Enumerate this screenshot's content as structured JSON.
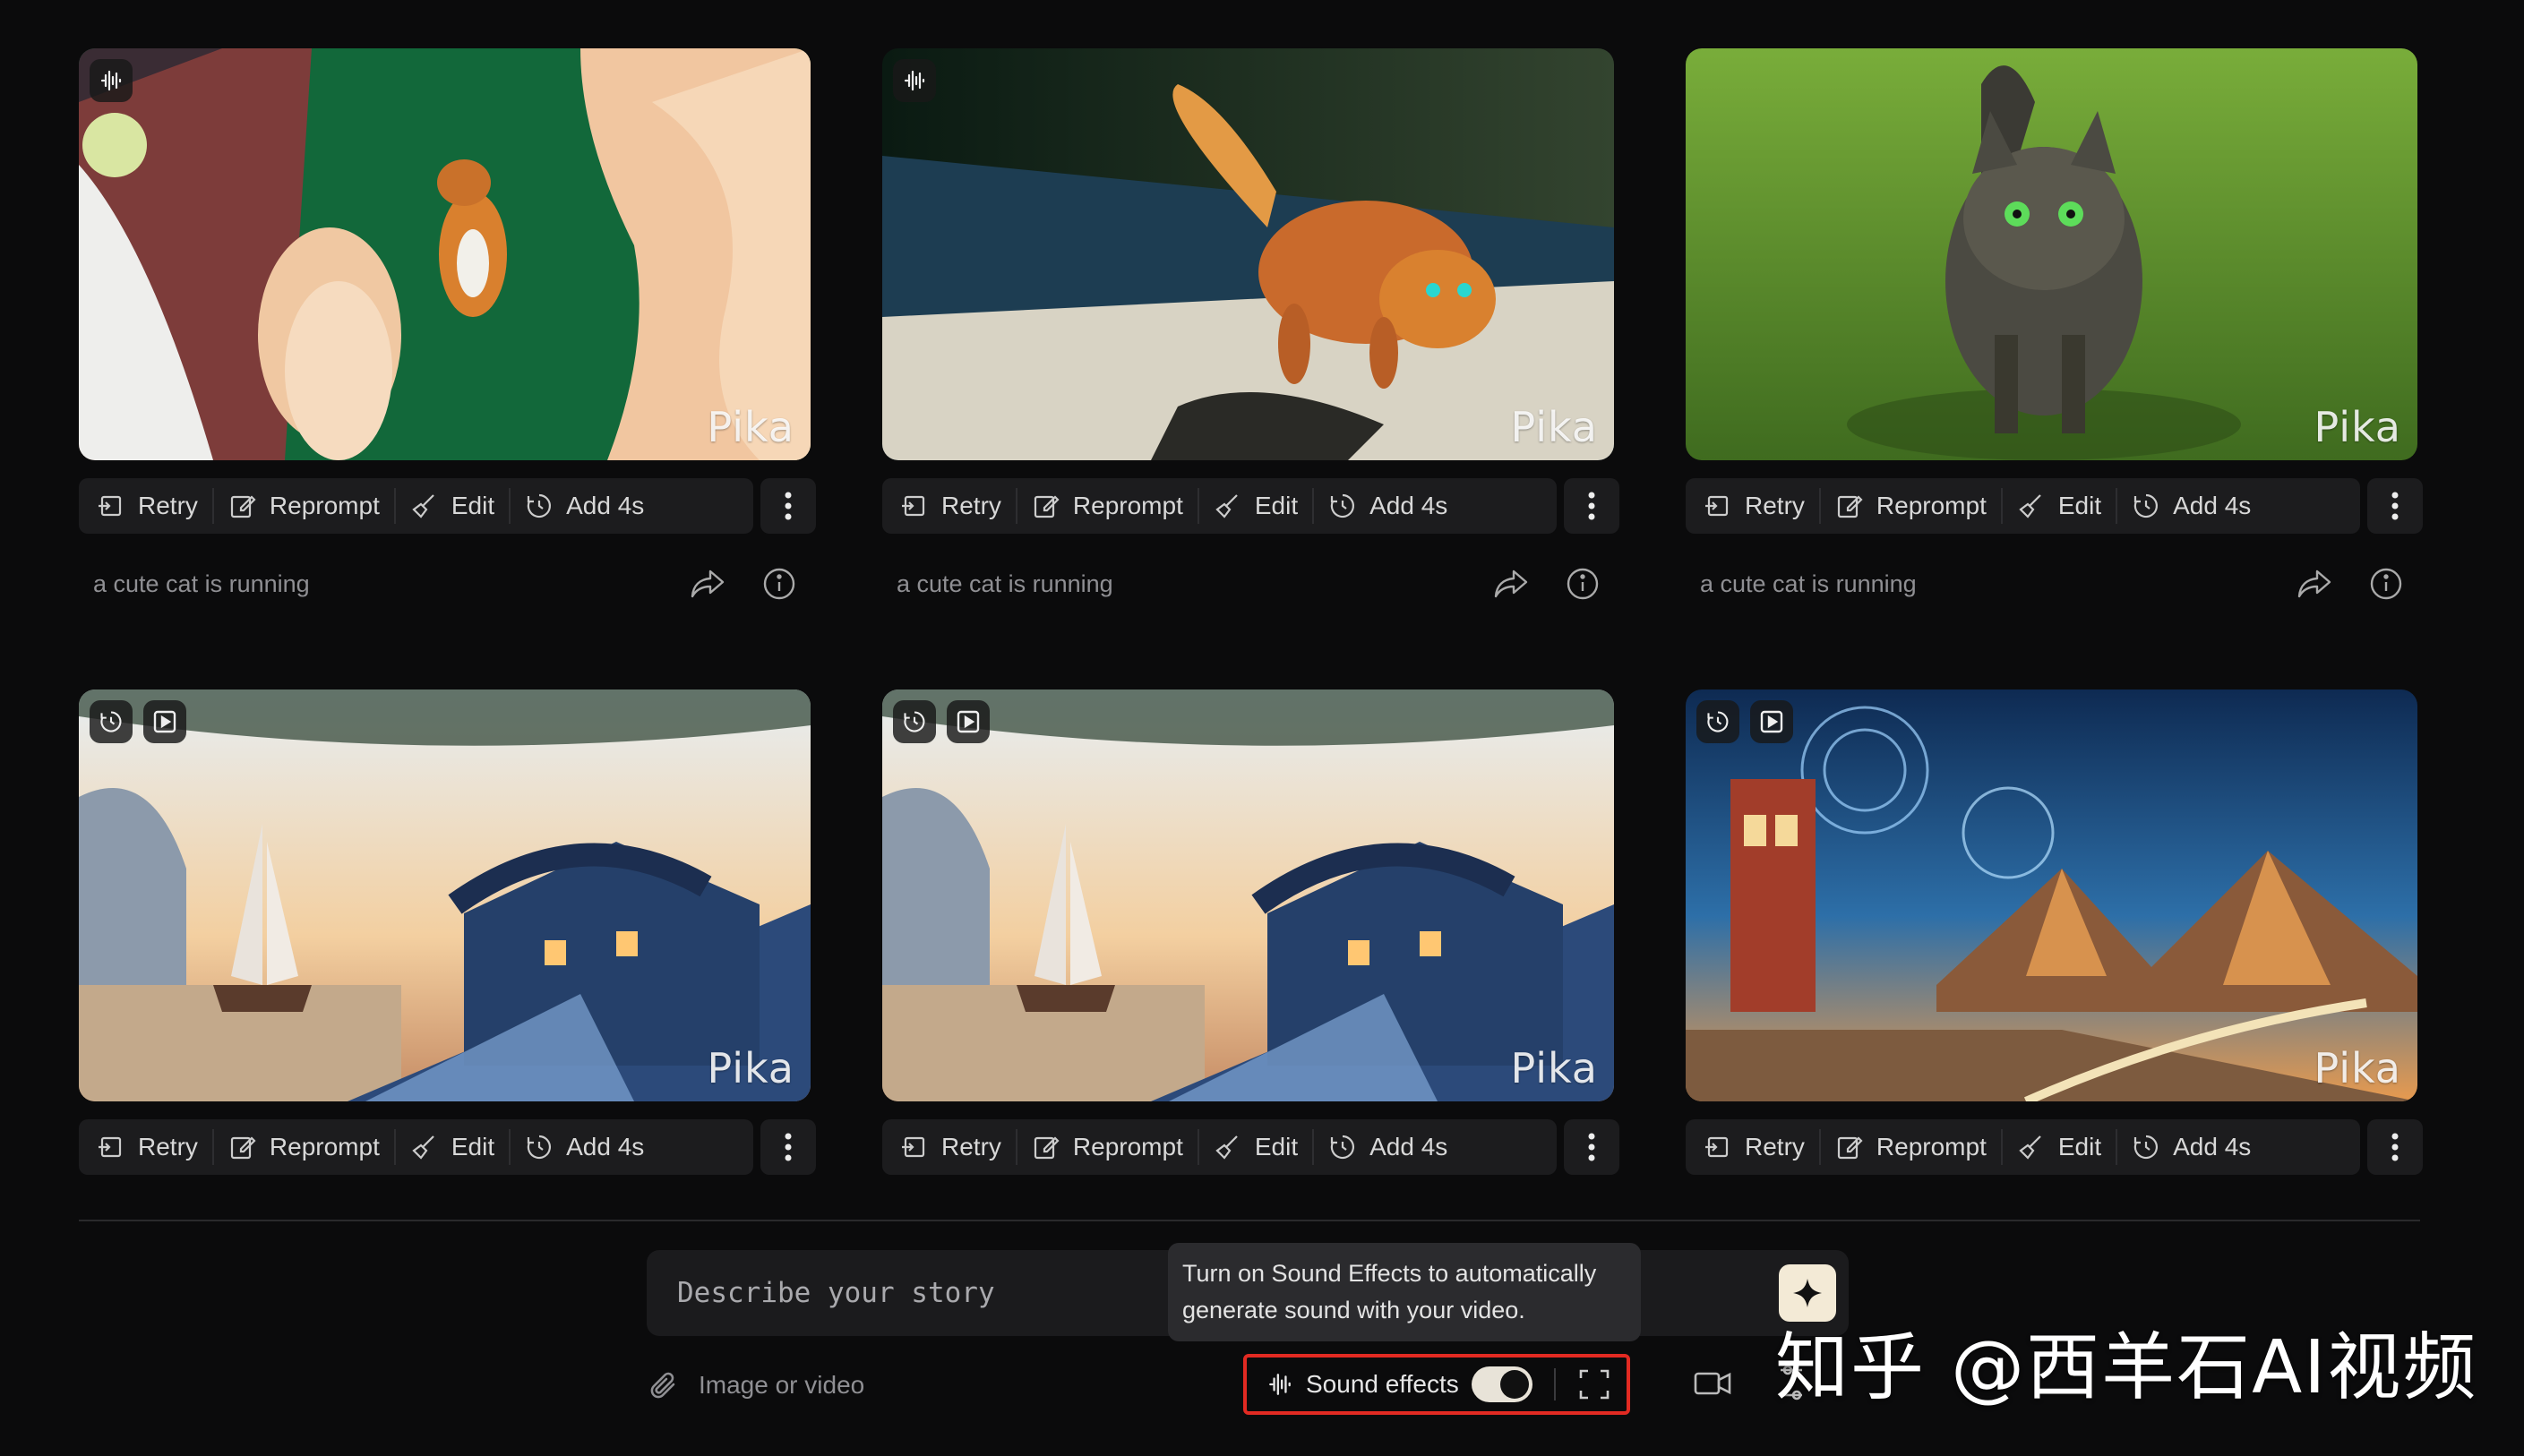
{
  "cards": [
    {
      "prompt": "a cute cat is running",
      "watermark": "Pika",
      "badges": [
        "sound-wave-icon"
      ]
    },
    {
      "prompt": "a cute cat is running",
      "watermark": "Pika",
      "badges": [
        "sound-wave-icon"
      ]
    },
    {
      "prompt": "a cute cat is running",
      "watermark": "Pika",
      "badges": []
    },
    {
      "prompt": "",
      "watermark": "Pika",
      "badges": [
        "extend-icon",
        "play-icon"
      ]
    },
    {
      "prompt": "",
      "watermark": "Pika",
      "badges": [
        "extend-icon",
        "play-icon"
      ]
    },
    {
      "prompt": "",
      "watermark": "Pika",
      "badges": [
        "extend-icon",
        "play-icon"
      ]
    }
  ],
  "actions": {
    "retry": "Retry",
    "reprompt": "Reprompt",
    "edit": "Edit",
    "add": "Add 4s"
  },
  "composer": {
    "placeholder": "Describe your story",
    "attach_label": "Image or video",
    "sound_effects_label": "Sound effects",
    "sound_effects_on": true
  },
  "tooltip": {
    "line1": "Turn on Sound Effects to automatically",
    "line2": "generate sound with your video."
  },
  "watermark_overlay": "知乎 @西羊石AI视频",
  "colors": {
    "background": "#0b0b0c",
    "panel": "#1c1c1e",
    "highlight": "#e22a22",
    "sparkle_button": "#f3ead6"
  }
}
